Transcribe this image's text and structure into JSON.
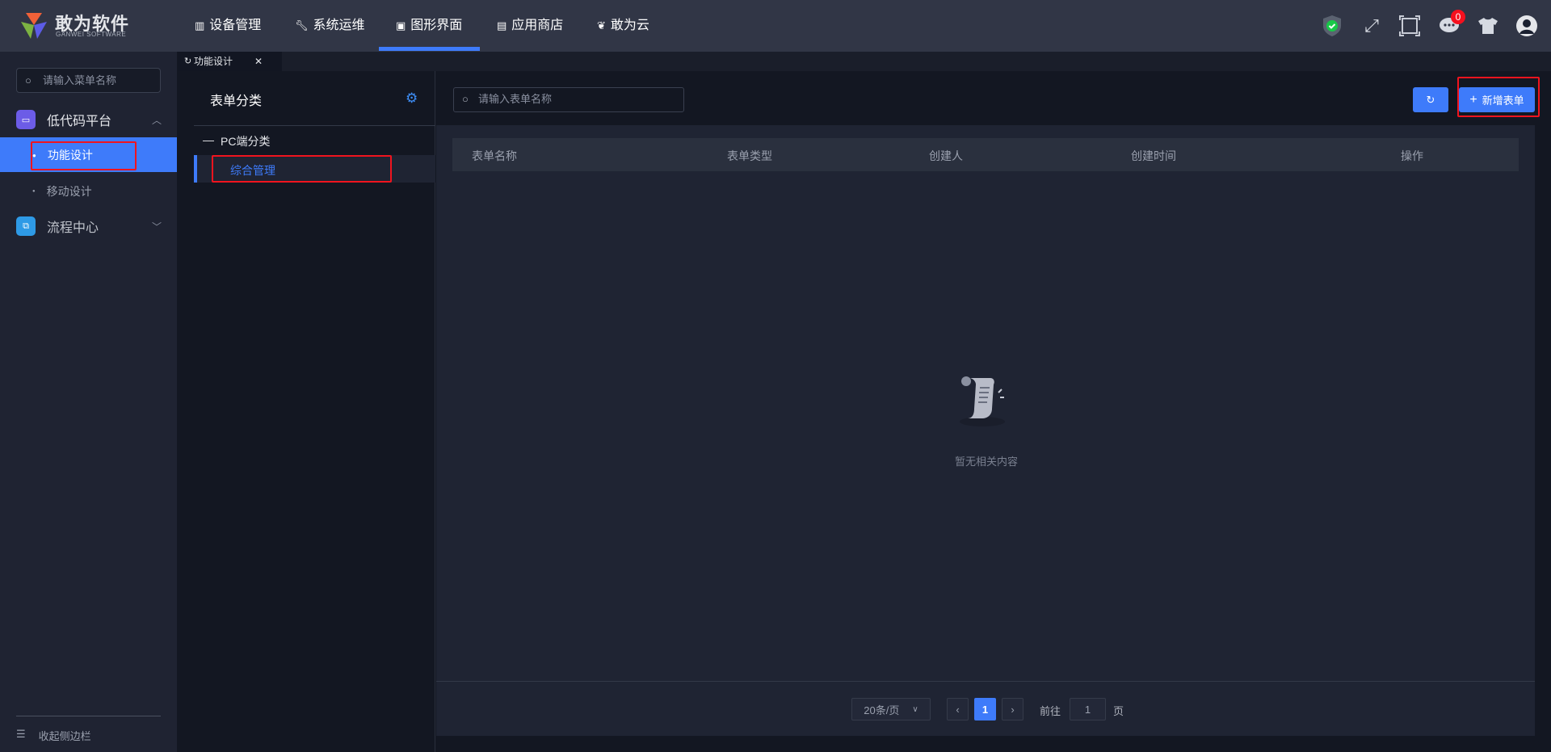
{
  "header": {
    "brand": "敢为软件",
    "brand_sub": "GANWEI SOFTWARE",
    "nav": [
      {
        "label": "设备管理",
        "icon": "device-icon"
      },
      {
        "label": "系统运维",
        "icon": "wrench-icon"
      },
      {
        "label": "图形界面",
        "icon": "monitor-icon",
        "active": true
      },
      {
        "label": "应用商店",
        "icon": "store-icon"
      },
      {
        "label": "敢为云",
        "icon": "cloud-icon"
      }
    ],
    "message_count": "0"
  },
  "sidebar": {
    "search_placeholder": "请输入菜单名称",
    "groups": [
      {
        "label": "低代码平台",
        "items": [
          {
            "label": "功能设计",
            "active": true
          },
          {
            "label": "移动设计"
          }
        ]
      },
      {
        "label": "流程中心"
      }
    ],
    "collapse_label": "收起侧边栏"
  },
  "tabs": [
    {
      "label": "功能设计"
    }
  ],
  "category": {
    "title": "表单分类",
    "tree_root": "PC端分类",
    "tree_child": "综合管理"
  },
  "main": {
    "search_placeholder": "请输入表单名称",
    "add_button": "新增表单",
    "columns": [
      "表单名称",
      "表单类型",
      "创建人",
      "创建时间",
      "操作"
    ],
    "empty_text": "暂无相关内容",
    "pagination": {
      "page_size": "20条/页",
      "current_page": "1",
      "goto_label": "前往",
      "goto_value": "1",
      "page_suffix": "页"
    }
  },
  "colors": {
    "accent": "#3e7bfa",
    "highlight": "#f0141e"
  }
}
